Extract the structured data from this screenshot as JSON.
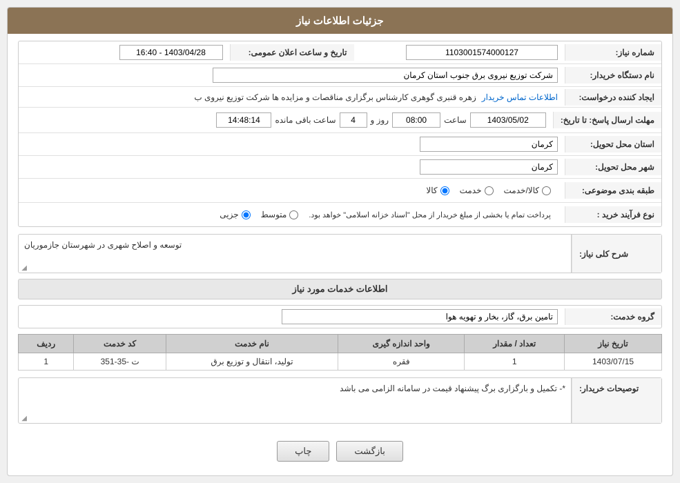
{
  "header": {
    "title": "جزئیات اطلاعات نیاز"
  },
  "fields": {
    "need_number_label": "شماره نیاز:",
    "need_number_value": "1103001574000127",
    "announce_datetime_label": "تاریخ و ساعت اعلان عمومی:",
    "announce_datetime_value": "1403/04/28 - 16:40",
    "buyer_org_label": "نام دستگاه خریدار:",
    "buyer_org_value": "شرکت توزیع نیروی برق جنوب استان کرمان",
    "creator_label": "ایجاد کننده درخواست:",
    "creator_value": "زهره قنبری گوهری کارشناس برگزاری مناقصات و مزایده ها شرکت توزیع نیروی ب",
    "creator_link": "اطلاعات تماس خریدار",
    "response_deadline_label": "مهلت ارسال پاسخ: تا تاریخ:",
    "response_date_value": "1403/05/02",
    "response_time_label": "ساعت",
    "response_time_value": "08:00",
    "response_days_label": "روز و",
    "response_days_value": "4",
    "response_remaining_label": "ساعت باقی مانده",
    "response_remaining_value": "14:48:14",
    "province_label": "استان محل تحویل:",
    "province_value": "کرمان",
    "city_label": "شهر محل تحویل:",
    "city_value": "کرمان",
    "category_label": "طبقه بندی موضوعی:",
    "category_radio1": "کالا",
    "category_radio2": "خدمت",
    "category_radio3": "کالا/خدمت",
    "purchase_type_label": "نوع فرآیند خرید :",
    "purchase_radio1": "جزیی",
    "purchase_radio2": "متوسط",
    "purchase_note": "پرداخت تمام یا بخشی از مبلغ خریدار از محل \"اسناد خزانه اسلامی\" خواهد بود.",
    "general_description_title": "شرح کلی نیاز:",
    "general_description_value": "توسعه و اصلاح شهری در شهرستان جازموریان",
    "services_title": "اطلاعات خدمات مورد نیاز",
    "service_group_label": "گروه خدمت:",
    "service_group_value": "تامین برق، گاز، بخار و تهویه هوا",
    "table_headers": {
      "row_num": "ردیف",
      "service_code": "کد خدمت",
      "service_name": "نام خدمت",
      "unit": "واحد اندازه گیری",
      "quantity": "تعداد / مقدار",
      "need_date": "تاریخ نیاز"
    },
    "table_rows": [
      {
        "row_num": "1",
        "service_code": "ت -35-351",
        "service_name": "تولید، انتقال و توزیع برق",
        "unit": "فقره",
        "quantity": "1",
        "need_date": "1403/07/15"
      }
    ],
    "buyer_notes_label": "توصیحات خریدار:",
    "buyer_notes_value": "*- تکمیل و بارگزاری برگ پیشنهاد قیمت در سامانه الزامی می باشد"
  },
  "buttons": {
    "print": "چاپ",
    "back": "بازگشت"
  }
}
